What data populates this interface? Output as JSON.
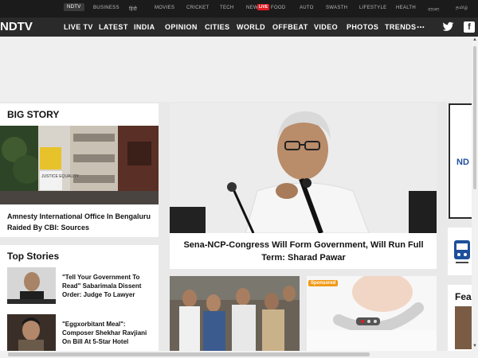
{
  "topbar": {
    "items": [
      "NDTV",
      "BUSINESS",
      "हिंदी",
      "MOVIES",
      "CRICKET",
      "TECH",
      "NEW",
      "FOOD",
      "AUTO",
      "SWASTH",
      "LIFESTYLE",
      "HEALTH",
      "বাংলা",
      "தமிழ்"
    ],
    "live_badge": "LIVE"
  },
  "navbar": {
    "logo_prefix": "",
    "logo_main": "NDTV",
    "items": [
      "LIVE TV",
      "LATEST",
      "INDIA",
      "OPINION",
      "CITIES",
      "WORLD",
      "OFFBEAT",
      "VIDEO",
      "PHOTOS",
      "TRENDS"
    ],
    "more": "..."
  },
  "big_story": {
    "title": "BIG STORY",
    "headline": "Amnesty International Office In Bengaluru Raided By CBI: Sources",
    "image_sign_text": "JUSTICE EQUALITY"
  },
  "lead_story": {
    "headline": "Sena-NCP-Congress Will Form Government, Will Run Full Term: Sharad Pawar"
  },
  "top_stories": {
    "title": "Top Stories",
    "items": [
      {
        "headline": "\"Tell Your Government To Read\" Sabarimala Dissent Order: Judge To Lawyer"
      },
      {
        "headline": "\"Eggxorbitant Meal\": Composer Shekhar Ravjiani On Bill At 5-Star Hotel"
      }
    ]
  },
  "promo": {
    "badge": "Sponsored"
  },
  "right_rail": {
    "logo_text": "ND",
    "feature_title": "Fea"
  },
  "colors": {
    "brand_red": "#e11b22",
    "nav_dark": "#2a2a2a",
    "top_dark": "#1b1b1b",
    "sponsored": "#f29a17"
  }
}
